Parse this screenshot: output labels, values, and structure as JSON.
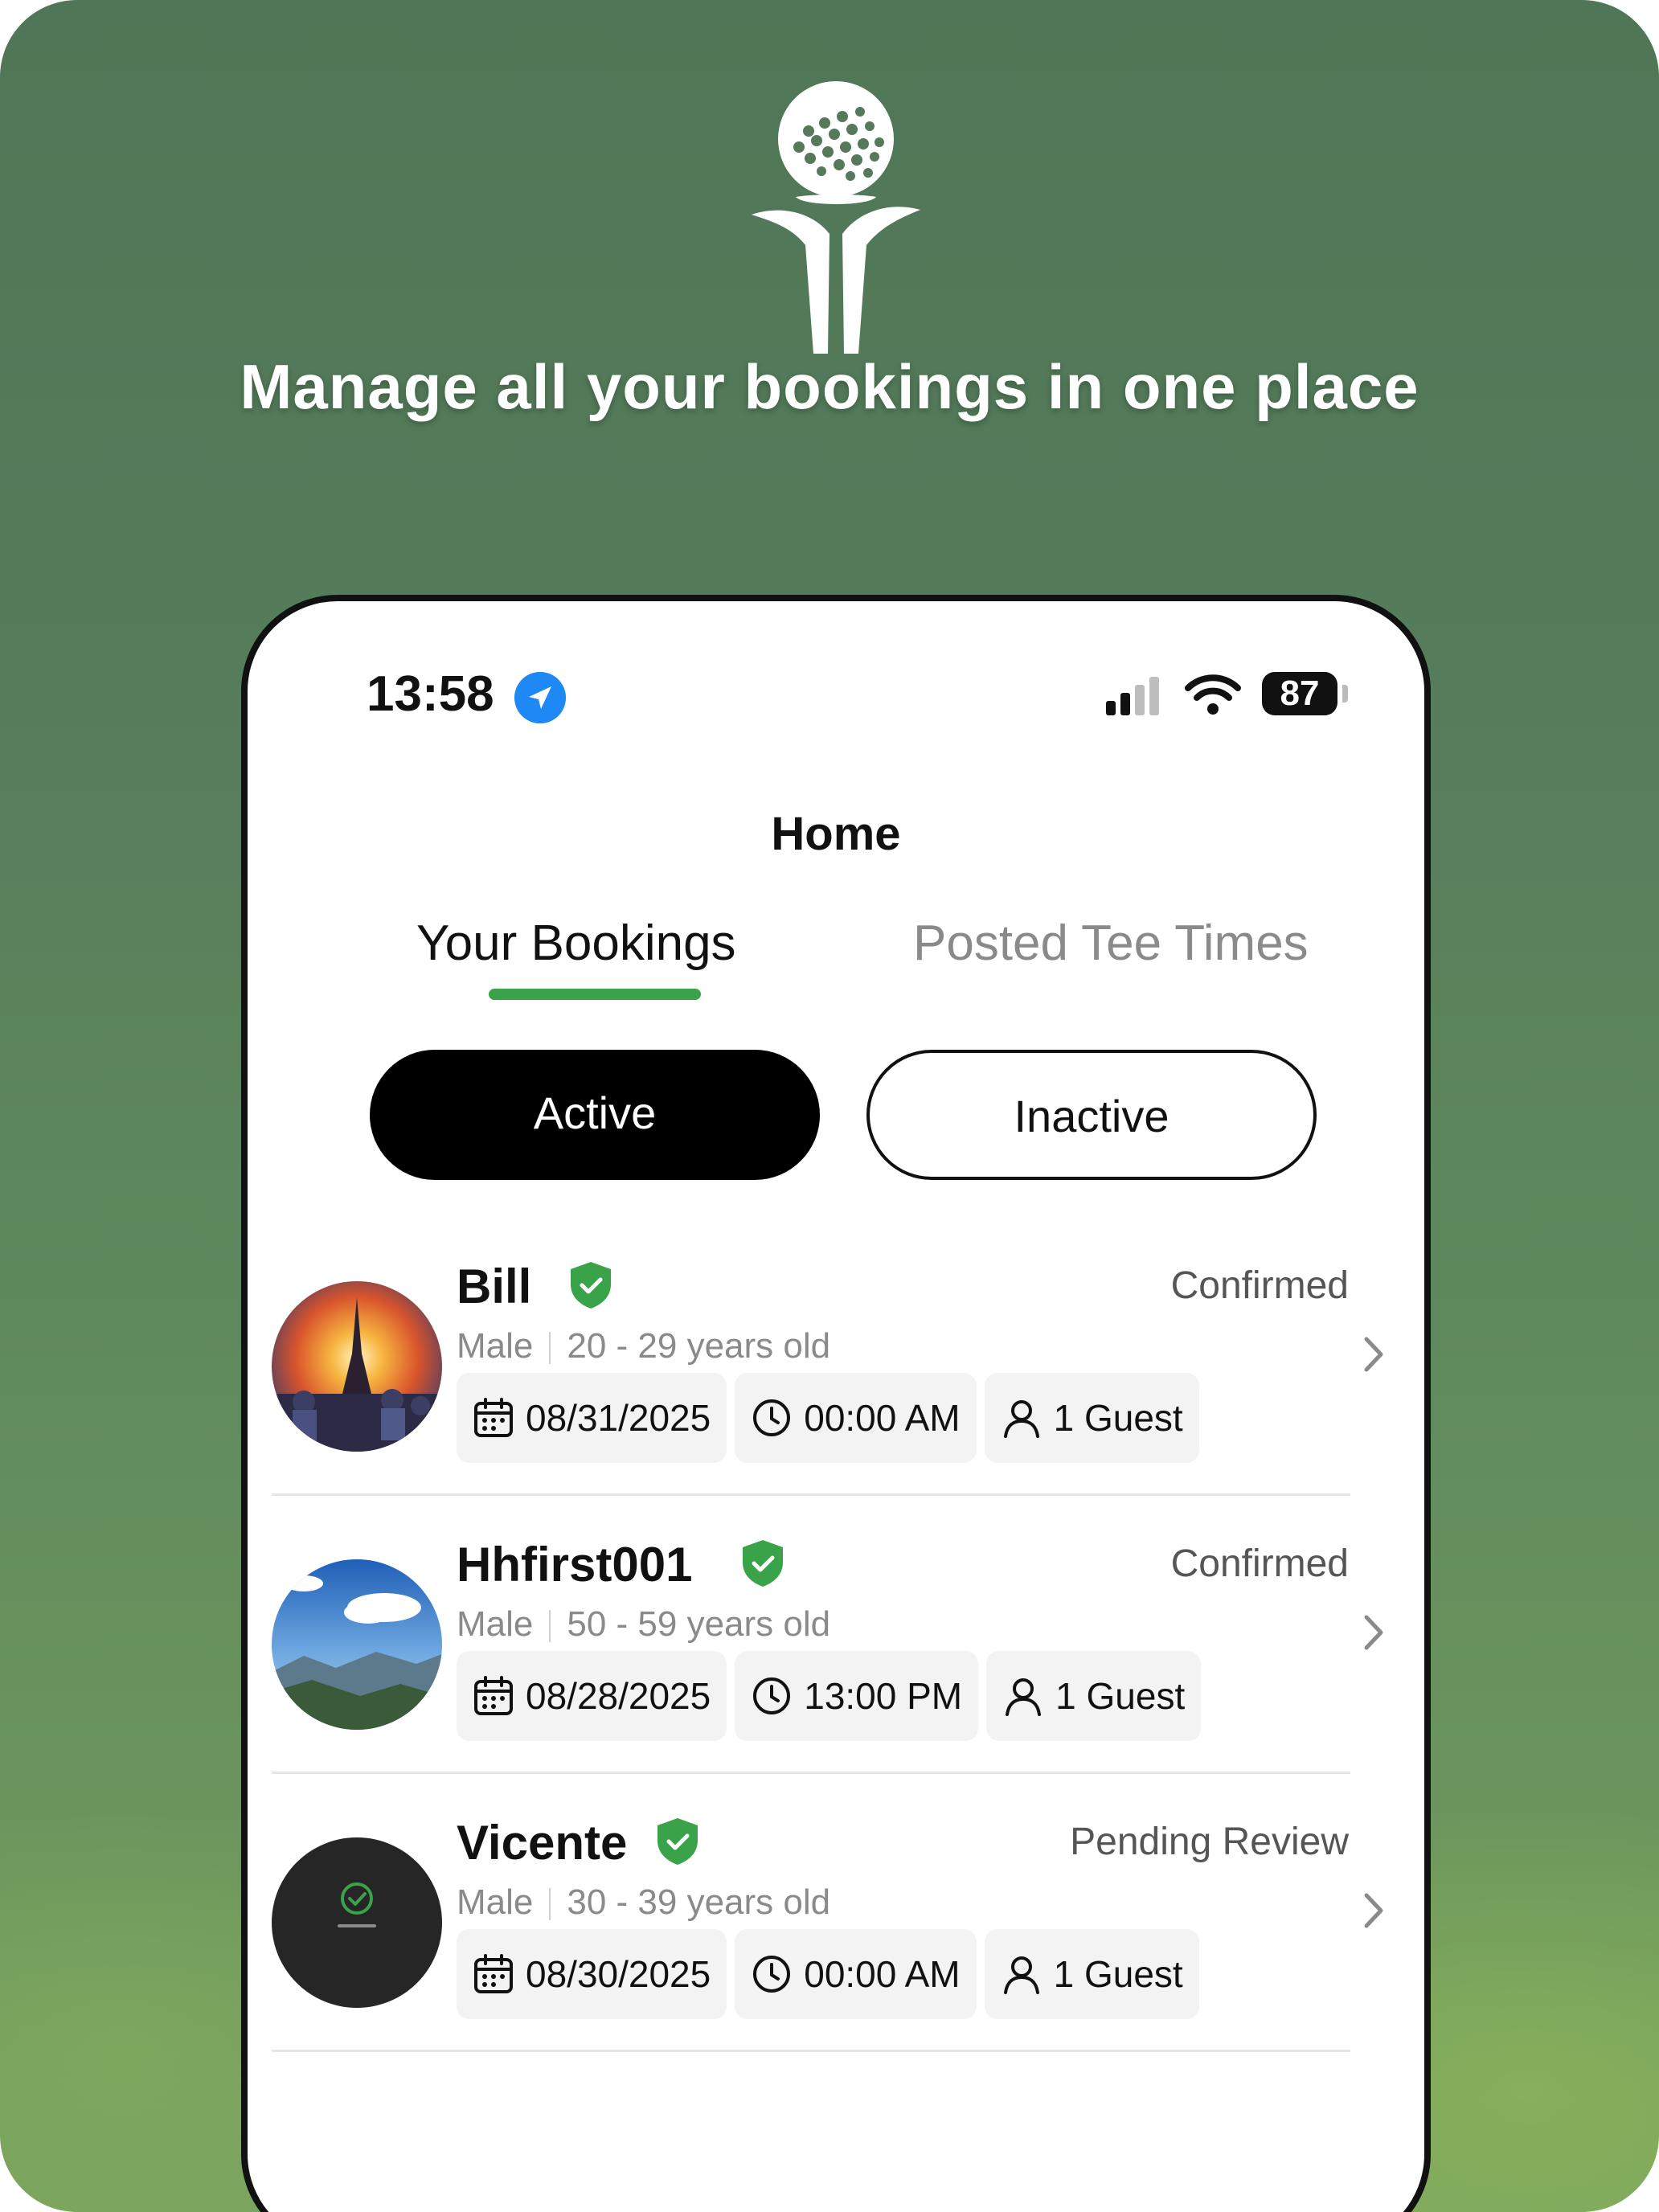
{
  "headline": "Manage all your bookings in one place",
  "status_bar": {
    "time": "13:58",
    "battery": "87"
  },
  "page_title": "Home",
  "tabs": [
    {
      "label": "Your Bookings",
      "active": true
    },
    {
      "label": "Posted Tee Times",
      "active": false
    }
  ],
  "filters": {
    "active": "Active",
    "inactive": "Inactive"
  },
  "bookings": [
    {
      "name": "Bill",
      "status": "Confirmed",
      "gender": "Male",
      "age": "20 - 29 years old",
      "date": "08/31/2025",
      "time": "00:00 AM",
      "guests": "1 Guest"
    },
    {
      "name": "Hhfirst001",
      "status": "Confirmed",
      "gender": "Male",
      "age": "50 - 59 years old",
      "date": "08/28/2025",
      "time": "13:00 PM",
      "guests": "1 Guest"
    },
    {
      "name": "Vicente",
      "status": "Pending Review",
      "gender": "Male",
      "age": "30 - 39 years old",
      "date": "08/30/2025",
      "time": "00:00 AM",
      "guests": "1 Guest"
    }
  ],
  "colors": {
    "accent": "#3aa34a",
    "verified": "#3aa34a",
    "location": "#1e88f5"
  }
}
